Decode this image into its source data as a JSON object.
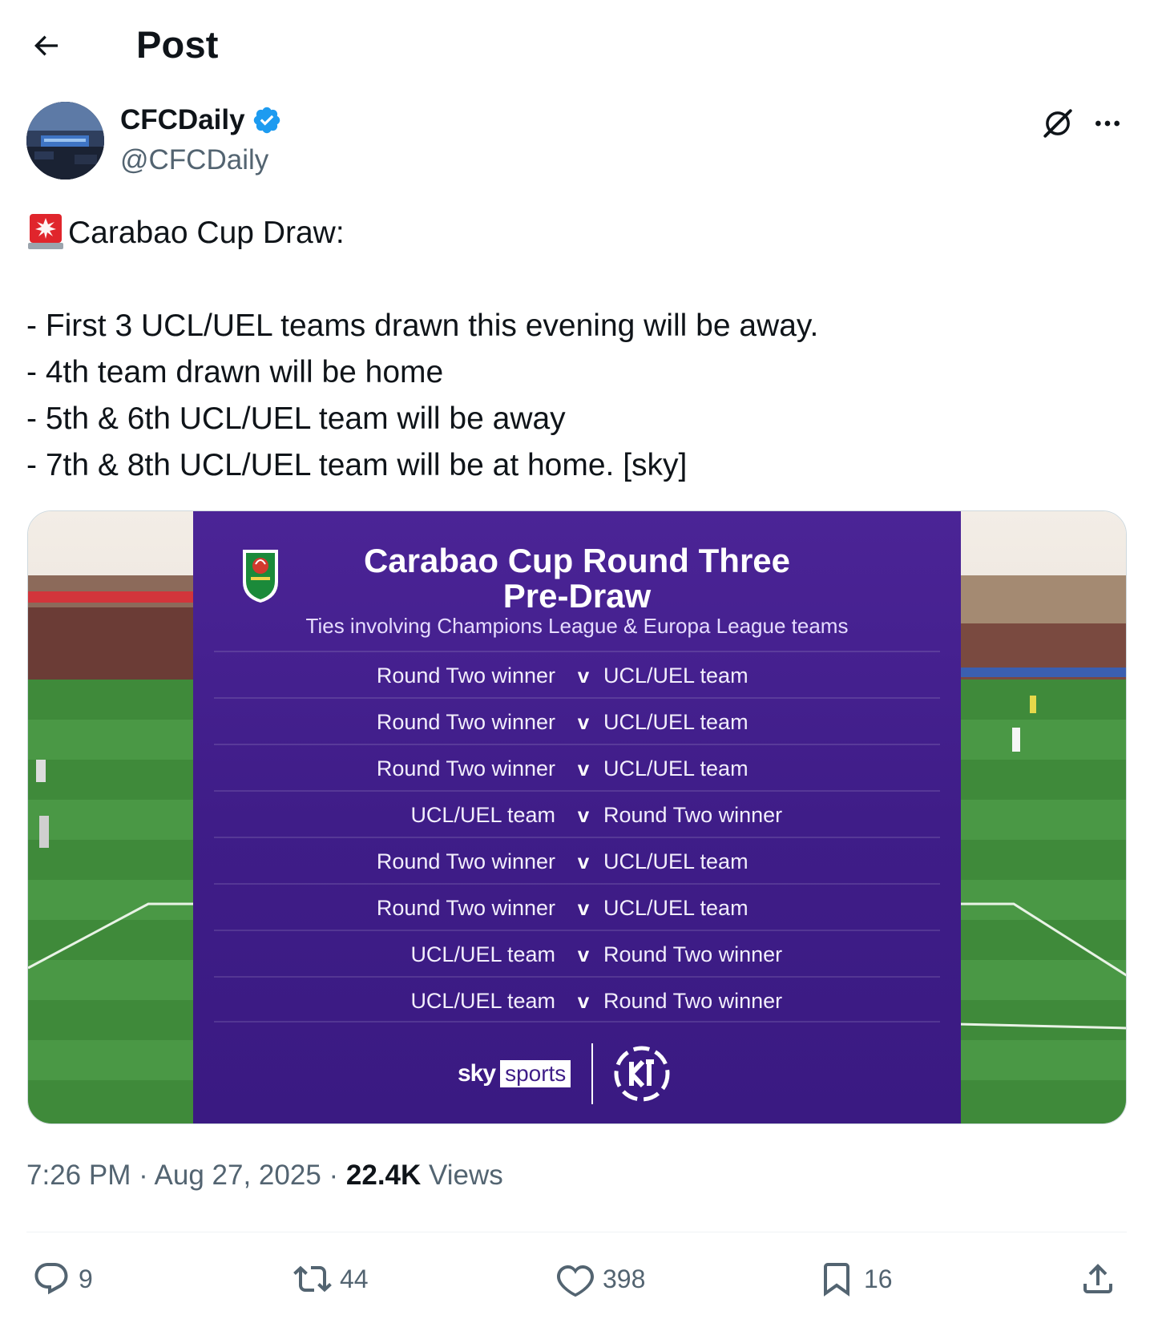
{
  "header": {
    "title": "Post"
  },
  "author": {
    "name": "CFCDaily",
    "handle": "@CFCDaily"
  },
  "tweet": {
    "emoji": "🚨",
    "lines": [
      "Carabao Cup Draw:",
      "",
      "- First 3 UCL/UEL teams drawn this evening will be away.",
      "- 4th team drawn will be home",
      "- 5th & 6th UCL/UEL team will be away",
      "- 7th & 8th UCL/UEL team will be at home. [sky]"
    ]
  },
  "media": {
    "title_line1": "Carabao Cup Round Three",
    "title_line2": "Pre-Draw",
    "subtitle": "Ties involving Champions League & Europa League teams",
    "fixtures": [
      {
        "home": "Round Two winner",
        "v": "v",
        "away": "UCL/UEL team"
      },
      {
        "home": "Round Two winner",
        "v": "v",
        "away": "UCL/UEL team"
      },
      {
        "home": "Round Two winner",
        "v": "v",
        "away": "UCL/UEL team"
      },
      {
        "home": "UCL/UEL team",
        "v": "v",
        "away": "Round Two winner"
      },
      {
        "home": "Round Two winner",
        "v": "v",
        "away": "UCL/UEL team"
      },
      {
        "home": "Round Two winner",
        "v": "v",
        "away": "UCL/UEL team"
      },
      {
        "home": "UCL/UEL team",
        "v": "v",
        "away": "Round Two winner"
      },
      {
        "home": "UCL/UEL team",
        "v": "v",
        "away": "Round Two winner"
      }
    ],
    "broadcaster_sky": "sky",
    "broadcaster_sports": "sports",
    "colors": {
      "panel": "#3f1d88",
      "pitch": "#3f8a3a"
    }
  },
  "meta": {
    "time": "7:26 PM",
    "sep1": " · ",
    "date": "Aug 27, 2025",
    "sep2": " · ",
    "views_count": "22.4K",
    "views_label": " Views"
  },
  "actions": {
    "replies": "9",
    "reposts": "44",
    "likes": "398",
    "bookmarks": "16"
  },
  "icons": [
    "back-arrow-icon",
    "verified-badge-icon",
    "grok-icon",
    "more-icon",
    "reply-icon",
    "repost-icon",
    "like-icon",
    "bookmark-icon",
    "share-icon"
  ]
}
